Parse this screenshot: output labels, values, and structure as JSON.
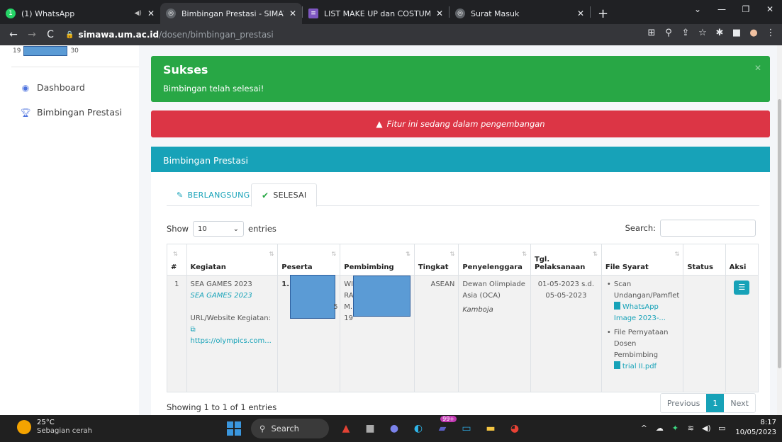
{
  "browser": {
    "tabs": [
      {
        "title": "(1) WhatsApp",
        "icon": "whatsapp-icon",
        "color": "#25d366"
      },
      {
        "title": "Bimbingan Prestasi - SIMAWA DO",
        "icon": "site-icon",
        "color": "#5f6368"
      },
      {
        "title": "LIST MAKE UP dan COSTUM EPH",
        "icon": "sheets-icon",
        "color": "#7e57c2"
      },
      {
        "title": "Surat Masuk",
        "icon": "site-icon",
        "color": "#5f6368"
      }
    ],
    "url_host": "simawa.um.ac.id",
    "url_path": "/dosen/bimbingan_prestasi"
  },
  "sidebar": {
    "id_prefix": "19",
    "id_suffix": "30",
    "items": [
      {
        "label": "Dashboard",
        "icon": "dashboard-icon"
      },
      {
        "label": "Bimbingan Prestasi",
        "icon": "trophy-icon"
      }
    ]
  },
  "alerts": {
    "success_title": "Sukses",
    "success_body": "Bimbingan telah selesai!",
    "danger_text": "Fitur ini sedang dalam pengembangan"
  },
  "card": {
    "title": "Bimbingan Prestasi",
    "tab_ongoing": "BERLANGSUNG",
    "tab_done": "SELESAI",
    "show_label": "Show",
    "entries_value": "10",
    "entries_label": "entries",
    "search_label": "Search:",
    "columns": [
      "#",
      "Kegiatan",
      "Peserta",
      "Pembimbing",
      "Tingkat",
      "Penyelenggara",
      "Tgl. Pelaksanaan",
      "File Syarat",
      "Status",
      "Aksi"
    ],
    "row": {
      "no": "1",
      "kegiatan": "SEA GAMES 2023",
      "kegiatan_sub": "SEA GAMES 2023",
      "url_label": "URL/Website Kegiatan:",
      "url": "https://olympics.com...",
      "peserta": "1.",
      "pembimbing_1": "WI",
      "pembimbing_2": "RA",
      "pembimbing_3": "M.I",
      "pembimbing_4": "19",
      "pembimbing_s": "5",
      "tingkat": "ASEAN",
      "penyelenggara": "Dewan Olimpiade Asia (OCA)",
      "lokasi": "Kamboja",
      "tgl": "01-05-2023 s.d. 05-05-2023",
      "file1_label": "Scan Undangan/Pamflet",
      "file1_link": "WhatsApp Image 2023-...",
      "file2_label": "File Pernyataan Dosen Pembimbing",
      "file2_link": "trial II.pdf",
      "status": ""
    },
    "info": "Showing 1 to 1 of 1 entries",
    "prev": "Previous",
    "page": "1",
    "next": "Next"
  },
  "taskbar": {
    "temp": "25°C",
    "weather": "Sebagian cerah",
    "search": "Search",
    "badge": "99+",
    "time": "8:17",
    "date": "10/05/2023"
  }
}
